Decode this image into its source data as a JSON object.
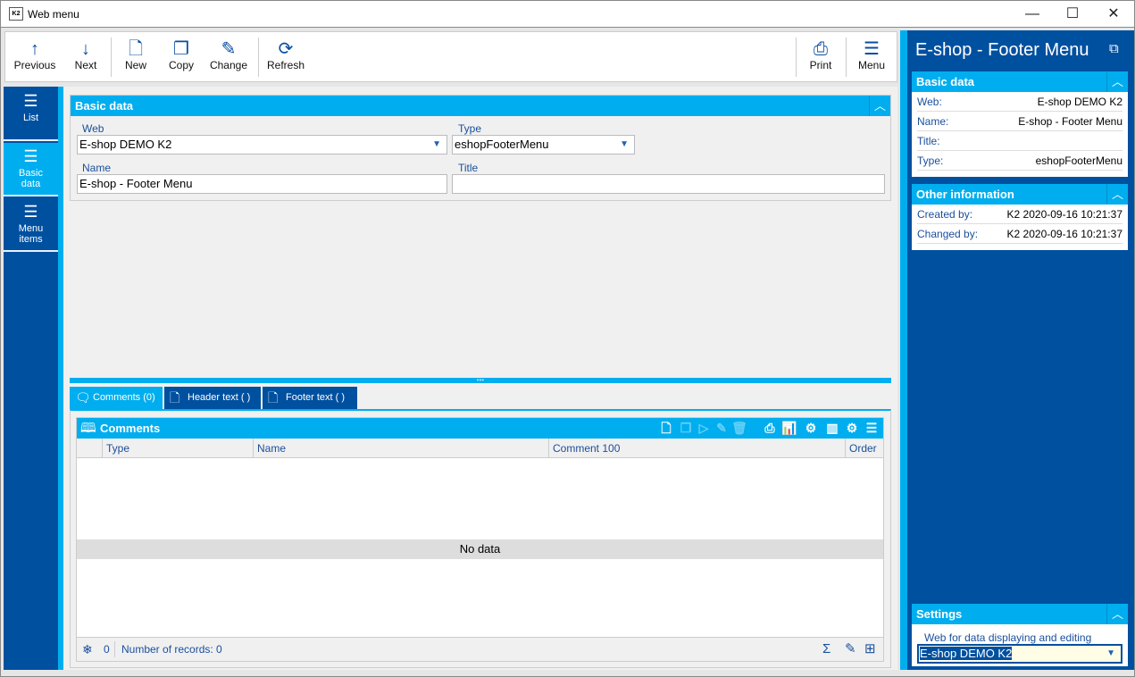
{
  "window": {
    "title": "Web menu",
    "minimize": "—",
    "maximize": "☐",
    "close": "✕"
  },
  "toolbar": {
    "previous": "Previous",
    "next": "Next",
    "new": "New",
    "copy": "Copy",
    "change": "Change",
    "refresh": "Refresh",
    "print": "Print",
    "menu": "Menu"
  },
  "nav": [
    {
      "label": "List"
    },
    {
      "label": "Basic data"
    },
    {
      "label": "Menu items"
    }
  ],
  "basic": {
    "header": "Basic data",
    "web_label": "Web",
    "web_value": "E-shop DEMO K2",
    "type_label": "Type",
    "type_value": "eshopFooterMenu",
    "name_label": "Name",
    "name_value": "E-shop - Footer Menu",
    "title_label": "Title",
    "title_value": ""
  },
  "tabs": [
    {
      "label": "Comments (0)"
    },
    {
      "label": "Header text ( )"
    },
    {
      "label": "Footer text ( )"
    }
  ],
  "comments": {
    "header": "Comments",
    "columns": [
      "Type",
      "Name",
      "Comment 100",
      "Order"
    ],
    "empty": "No data",
    "footer_count": "0",
    "records": "Number of records: 0"
  },
  "right": {
    "title": "E-shop - Footer Menu",
    "basic_header": "Basic data",
    "basic_rows": [
      {
        "k": "Web:",
        "v": "E-shop DEMO K2"
      },
      {
        "k": "Name:",
        "v": "E-shop - Footer Menu"
      },
      {
        "k": "Title:",
        "v": ""
      },
      {
        "k": "Type:",
        "v": "eshopFooterMenu"
      }
    ],
    "other_header": "Other information",
    "other_rows": [
      {
        "k": "Created by:",
        "v": "K2 2020-09-16 10:21:37"
      },
      {
        "k": "Changed by:",
        "v": "K2 2020-09-16 10:21:37"
      }
    ],
    "settings_header": "Settings",
    "settings_label": "Web for data displaying and editing",
    "settings_value": "E-shop DEMO K2"
  }
}
